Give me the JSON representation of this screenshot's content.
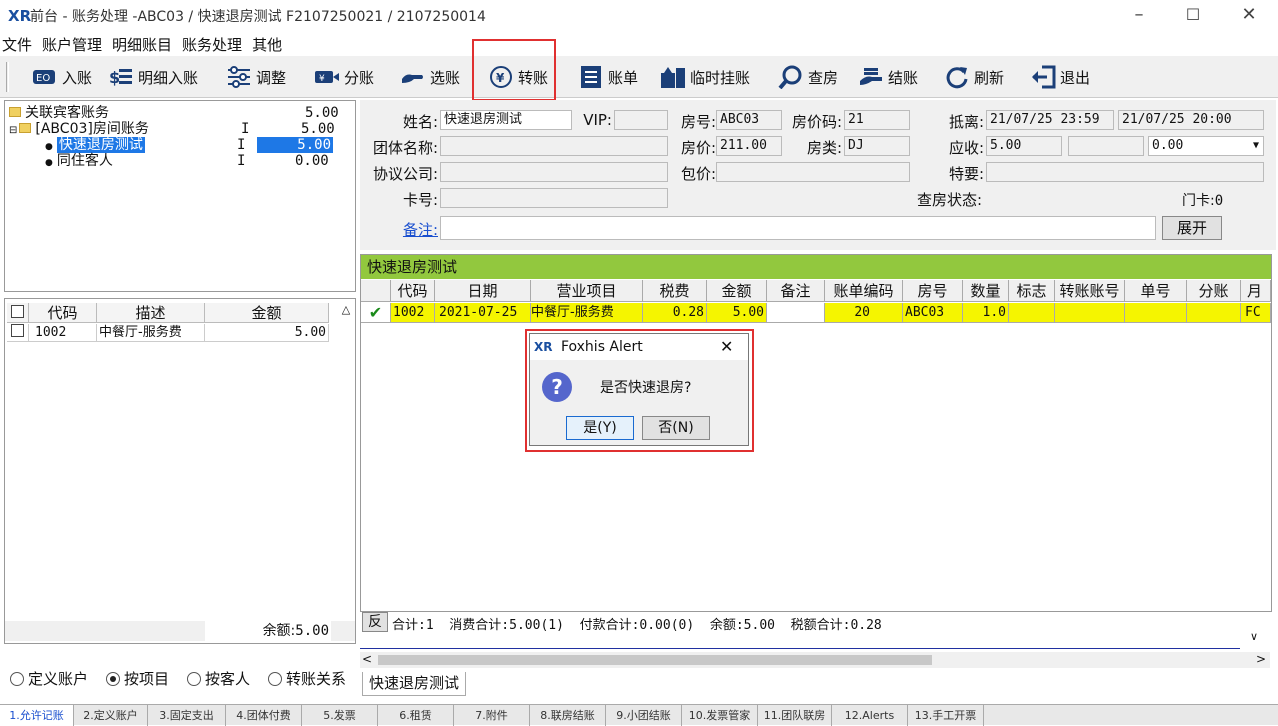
{
  "title_bar": {
    "title": "前台 - 账务处理 -ABC03 / 快速退房测试 F2107250021 / 2107250014",
    "logo": "XR"
  },
  "menu": [
    "文件",
    "账户管理",
    "明细账目",
    "账务处理",
    "其他"
  ],
  "toolbar": [
    {
      "label": "入账",
      "icon": "post-icon"
    },
    {
      "label": "明细入账",
      "icon": "detail-post-icon"
    },
    {
      "label": "调整",
      "icon": "adjust-icon"
    },
    {
      "label": "分账",
      "icon": "split-icon"
    },
    {
      "label": "选账",
      "icon": "select-icon"
    },
    {
      "label": "转账",
      "icon": "transfer-yen-icon"
    },
    {
      "label": "账单",
      "icon": "bill-icon"
    },
    {
      "label": "临时挂账",
      "icon": "temp-hang-icon"
    },
    {
      "label": "查房",
      "icon": "room-check-icon"
    },
    {
      "label": "结账",
      "icon": "checkout-icon"
    },
    {
      "label": "刷新",
      "icon": "refresh-icon"
    },
    {
      "label": "退出",
      "icon": "exit-icon"
    }
  ],
  "tree": {
    "root": {
      "label": "关联宾客账务",
      "amount": "5.00"
    },
    "room": {
      "label": "[ABC03]房间账务",
      "flag": "I",
      "amount": "5.00"
    },
    "guest": {
      "label": "快速退房测试",
      "flag": "I",
      "amount": "5.00"
    },
    "coguest": {
      "label": "同住客人",
      "flag": "I",
      "amount": "0.00"
    }
  },
  "code_grid": {
    "headers": [
      "代码",
      "描述",
      "金额"
    ],
    "rows": [
      {
        "code": "1002",
        "desc": "中餐厅-服务费",
        "amount": "5.00"
      }
    ],
    "balance_label": "余额:",
    "balance": "5.00"
  },
  "radios": [
    {
      "label": "定义账户",
      "checked": false
    },
    {
      "label": "按项目",
      "checked": true
    },
    {
      "label": "按客人",
      "checked": false
    },
    {
      "label": "转账关系",
      "checked": false
    }
  ],
  "info": {
    "name_label": "姓名:",
    "name": "快速退房测试",
    "vip_label": "VIP:",
    "vip": "",
    "room_label": "房号:",
    "room": "ABC03",
    "rate_code_label": "房价码:",
    "rate_code": "21",
    "arrive_label": "抵离:",
    "arrive": "21/07/25 23:59",
    "depart": "21/07/25 20:00",
    "group_label": "团体名称:",
    "group": "",
    "price_label": "房价:",
    "price": "211.00",
    "room_type_label": "房类:",
    "room_type": "DJ",
    "receivable_label": "应收:",
    "receivable": "5.00",
    "receivable2": "",
    "receivable3": "0.00",
    "company_label": "协议公司:",
    "company": "",
    "package_label": "包价:",
    "package": "",
    "special_label": "特要:",
    "special": "",
    "card_label": "卡号:",
    "card": "",
    "check_status_label": "查房状态:",
    "door_card_label": "门卡:",
    "door_card": "0",
    "remark_label": "备注:",
    "remark": "",
    "expand_button": "展开"
  },
  "ledger": {
    "title": "快速退房测试",
    "headers": [
      "代码",
      "日期",
      "营业项目",
      "税费",
      "金额",
      "备注",
      "账单编码",
      "房号",
      "数量",
      "标志",
      "转账账号",
      "单号",
      "分账",
      "月"
    ],
    "rows": [
      {
        "code": "1002",
        "date": "2021-07-25",
        "item": "中餐厅-服务费",
        "tax": "0.28",
        "amount": "5.00",
        "note": "",
        "bill": "20",
        "room": "ABC03",
        "qty": "1.0",
        "flag": "",
        "transfer": "",
        "doc": "",
        "split": "",
        "extra": "FC"
      }
    ],
    "reverse_label": "反",
    "totals": "合计:1  消费合计:5.00(1)  付款合计:0.00(0)  余额:5.00  税额合计:0.28",
    "tab": "快速退房测试"
  },
  "bottom_tabs": [
    "1.允许记账",
    "2.定义账户",
    "3.固定支出",
    "4.团体付费",
    "5.发票",
    "6.租赁",
    "7.附件",
    "8.联房结账",
    "9.小团结账",
    "10.发票管家",
    "11.团队联房",
    "12.Alerts",
    "13.手工开票"
  ],
  "dialog": {
    "title": "Foxhis Alert",
    "logo": "XR",
    "message": "是否快速退房?",
    "yes": "是(Y)",
    "no": "否(N)"
  },
  "colors": {
    "grid_title": "#92c83e",
    "row_highlight": "#f5f500",
    "selection": "#1e78e6",
    "annotation": "#e03030"
  }
}
